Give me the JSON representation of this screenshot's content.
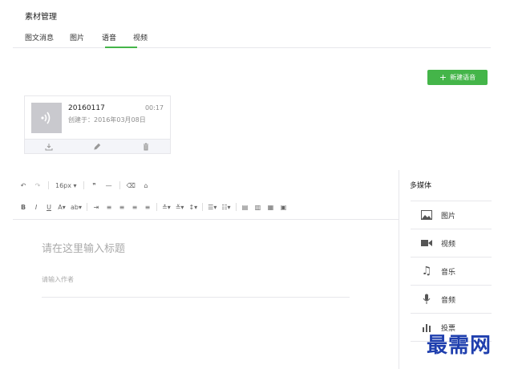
{
  "page": {
    "title": "素材管理"
  },
  "tabs": [
    {
      "label": "图文消息"
    },
    {
      "label": "图片"
    },
    {
      "label": "语音"
    },
    {
      "label": "视频"
    }
  ],
  "active_tab": "语音",
  "new_voice_button": {
    "label": "新建语音",
    "icon": "plus-icon"
  },
  "voice_card": {
    "name": "20160117",
    "duration": "00:17",
    "created": "创建于：2016年03月08日",
    "actions": [
      "download-icon",
      "edit-icon",
      "delete-icon"
    ]
  },
  "editor": {
    "font_size": "16px",
    "title_placeholder": "请在这里输入标题",
    "author_placeholder": "请输入作者"
  },
  "side_panel": {
    "title": "多媒体",
    "items": [
      {
        "label": "图片",
        "icon": "image-icon"
      },
      {
        "label": "视频",
        "icon": "video-icon"
      },
      {
        "label": "音乐",
        "icon": "music-icon"
      },
      {
        "label": "音频",
        "icon": "microphone-icon"
      },
      {
        "label": "投票",
        "icon": "vote-icon"
      }
    ]
  },
  "watermark": "最需网",
  "colors": {
    "accent": "#44b549",
    "border": "#e7e7eb",
    "thumb": "#c9c9ce",
    "watermark": "#1f3fae"
  }
}
